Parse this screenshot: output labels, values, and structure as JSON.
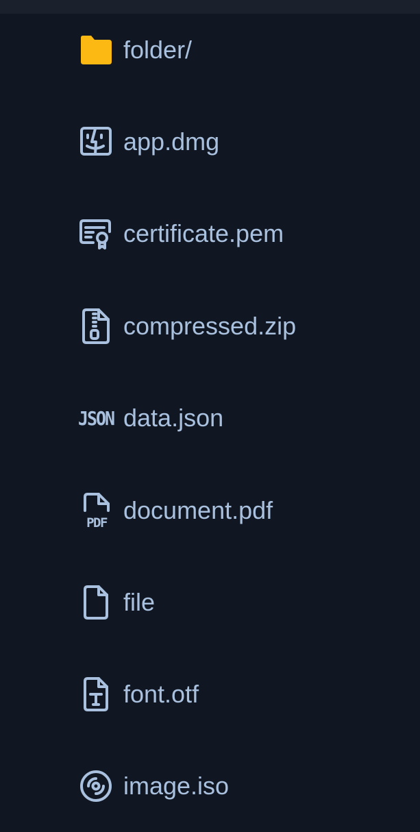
{
  "colors": {
    "background": "#111722",
    "top_bar": "#1a212c",
    "folder_icon": "#fcb913",
    "file_icon": "#a9c1de",
    "label": "#a9c1de"
  },
  "files": [
    {
      "name": "folder/",
      "icon": "folder-icon"
    },
    {
      "name": "app.dmg",
      "icon": "finder-icon"
    },
    {
      "name": "certificate.pem",
      "icon": "certificate-icon"
    },
    {
      "name": "compressed.zip",
      "icon": "zip-file-icon"
    },
    {
      "name": "data.json",
      "icon": "json-icon",
      "icon_text": "JSON"
    },
    {
      "name": "document.pdf",
      "icon": "pdf-file-icon",
      "icon_text": "PDF"
    },
    {
      "name": "file",
      "icon": "file-icon"
    },
    {
      "name": "font.otf",
      "icon": "font-file-icon"
    },
    {
      "name": "image.iso",
      "icon": "disc-icon"
    }
  ]
}
